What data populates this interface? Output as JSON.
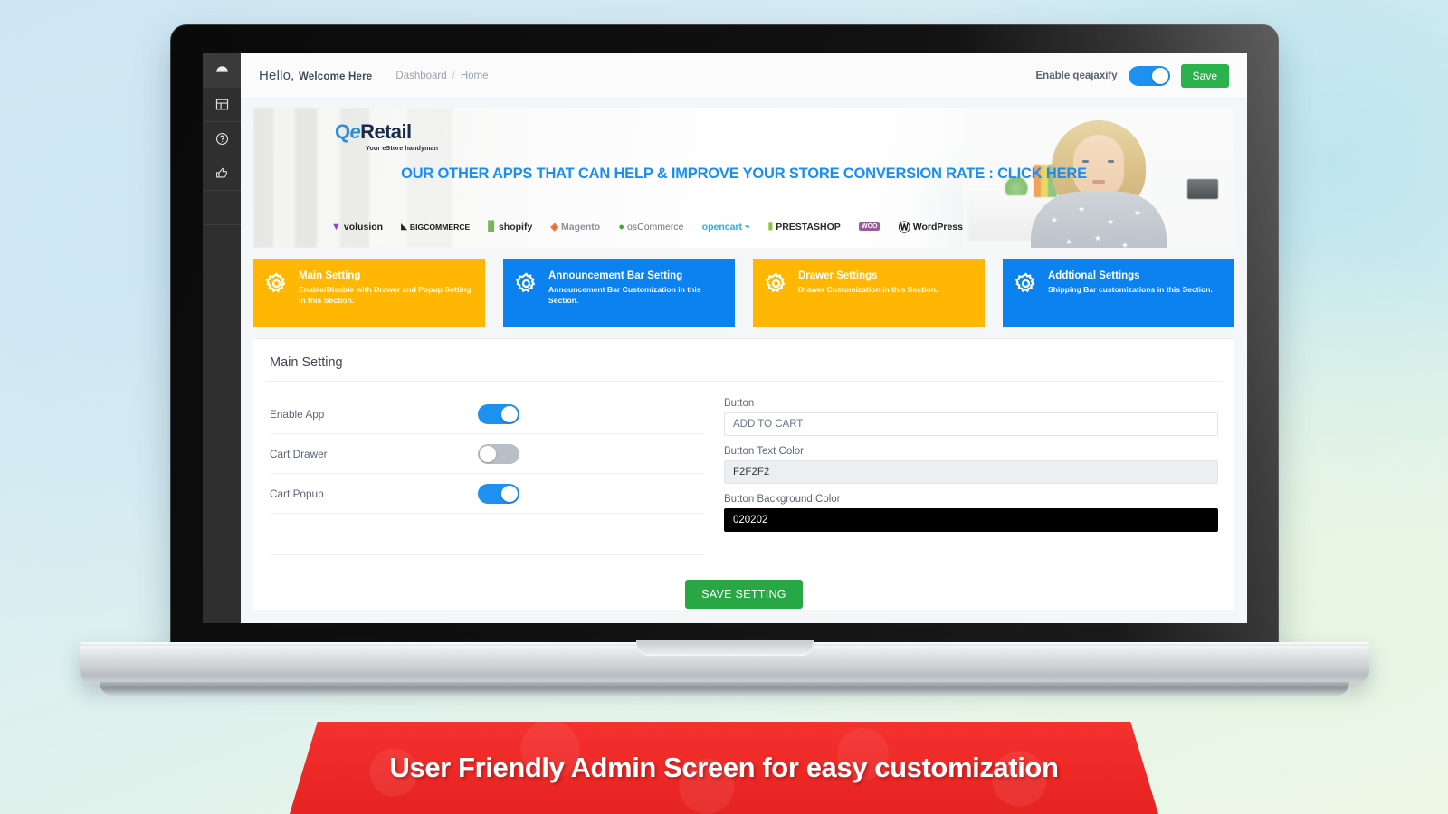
{
  "sidebar": {
    "items": [
      {
        "name": "dashboard",
        "icon": "gauge-icon"
      },
      {
        "name": "layout",
        "icon": "layout-icon"
      },
      {
        "name": "help",
        "icon": "question-circle-icon"
      },
      {
        "name": "thumbs-up",
        "icon": "thumbs-up-icon"
      }
    ]
  },
  "topbar": {
    "greeting": "Hello,",
    "greeting_sub": "Welcome Here",
    "breadcrumb_root": "Dashboard",
    "breadcrumb_sep": "/",
    "breadcrumb_current": "Home",
    "enable_label": "Enable qeajaxify",
    "enable_toggle_on": true,
    "save_label": "Save"
  },
  "promo": {
    "logo_q": "Q",
    "logo_e": "e",
    "logo_retail": "Retail",
    "logo_tagline": "Your eStore handyman",
    "headline": "OUR OTHER APPS THAT CAN HELP & IMPROVE YOUR STORE CONVERSION RATE : CLICK HERE",
    "platforms": [
      {
        "label": "volusion",
        "color": "#1f1f1f"
      },
      {
        "label": "BIGCOMMERCE",
        "color": "#1a1a1a"
      },
      {
        "label": "shopify",
        "color": "#2a2a2a"
      },
      {
        "label": "Magento",
        "color": "#8d9095"
      },
      {
        "label": "osCommerce",
        "color": "#6f7479"
      },
      {
        "label": "opencart",
        "color": "#2aaee0"
      },
      {
        "label": "PRESTASHOP",
        "color": "#2b2b2b"
      },
      {
        "label": "WOO",
        "color": "#9b5c9b"
      },
      {
        "label": "WordPress",
        "color": "#1f1f1f"
      }
    ]
  },
  "cards": [
    {
      "title": "Main Setting",
      "desc": "Enable/Disable with Drawer and Popup Setting in this Section.",
      "color": "#ffb703",
      "icon": "gear-icon"
    },
    {
      "title": "Announcement Bar Setting",
      "desc": "Announcement Bar Customization in this Section.",
      "color": "#0b82ef",
      "icon": "gear-icon"
    },
    {
      "title": "Drawer Settings",
      "desc": "Drawer Customization in this Section.",
      "color": "#ffb703",
      "icon": "gear-icon"
    },
    {
      "title": "Addtional Settings",
      "desc": "Shipping Bar customizations in this Section.",
      "color": "#0b82ef",
      "icon": "gear-icon"
    }
  ],
  "panel": {
    "title": "Main Setting",
    "toggles": [
      {
        "label": "Enable App",
        "on": true
      },
      {
        "label": "Cart Drawer",
        "on": false
      },
      {
        "label": "Cart Popup",
        "on": true
      }
    ],
    "fields": [
      {
        "label": "Button",
        "value": "ADD TO CART",
        "style": "white"
      },
      {
        "label": "Button Text Color",
        "value": "F2F2F2",
        "style": "grey"
      },
      {
        "label": "Button Background Color",
        "value": "020202",
        "style": "black"
      }
    ],
    "save_setting_label": "SAVE SETTING"
  },
  "ribbon": {
    "text": "User Friendly Admin Screen for easy customization",
    "color": "#ef2a28"
  }
}
